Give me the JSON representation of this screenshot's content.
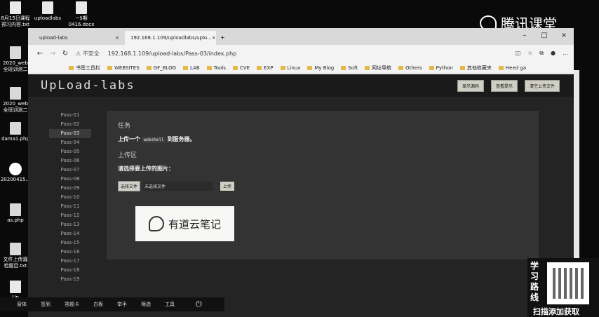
{
  "desktop": {
    "icons": [
      {
        "label": "8月15日课程 预习内容.txt"
      },
      {
        "label": "uploadlabs"
      },
      {
        "label": "~$期 0416.docx"
      },
      {
        "label": "2020_web 全班训测二"
      },
      {
        "label": "2020_web 全班训测二"
      },
      {
        "label": "dama1.php"
      },
      {
        "label": "20200415..."
      },
      {
        "label": "as.php"
      },
      {
        "label": "文件上传漏 检题目.txt"
      },
      {
        "label": "Up"
      }
    ],
    "tencent_logo": "腾讯课堂"
  },
  "browser": {
    "tabs": [
      {
        "label": "upload-labs"
      },
      {
        "label": "192.168.1.109/uploadlabs/uplo..."
      }
    ],
    "security_label": "不安全",
    "url": "192.168.1.109/upload-labs/Pass-03/index.php",
    "bookmarks": [
      "书签工具栏",
      "WEBSITES",
      "GF_BLOG",
      "LAB",
      "Tools",
      "CVE",
      "EXP",
      "Linux",
      "My Blog",
      "Soft",
      "网址导航",
      "Others",
      "Python",
      "其他收藏夹",
      "Heed ga"
    ]
  },
  "page": {
    "brand": "UpLoad-labs",
    "header_buttons": [
      "显示源码",
      "查看提示",
      "清空上传文件"
    ],
    "passes": [
      "Pass-01",
      "Pass-02",
      "Pass-03",
      "Pass-04",
      "Pass-05",
      "Pass-06",
      "Pass-07",
      "Pass-08",
      "Pass-09",
      "Pass-10",
      "Pass-11",
      "Pass-12",
      "Pass-13",
      "Pass-14",
      "Pass-15",
      "Pass-16",
      "Pass-17",
      "Pass-18",
      "Pass-19"
    ],
    "task_heading": "任务",
    "task_prefix": "上传一个",
    "task_code": "webshell",
    "task_suffix": "到服务器。",
    "upload_heading": "上传区",
    "upload_prompt": "请选择要上传的图片：",
    "file_button": "选择文件",
    "file_label": "未选择文件",
    "submit": "上传"
  },
  "overlay": {
    "youdao": "有道云笔记"
  },
  "qr_panel": {
    "side_text": "学习路线",
    "footer": "扫描添加获取"
  },
  "taskbar": {
    "items": [
      "窗体",
      "签到",
      "答题卡",
      "白板",
      "举手",
      "筛选",
      "工具"
    ]
  }
}
